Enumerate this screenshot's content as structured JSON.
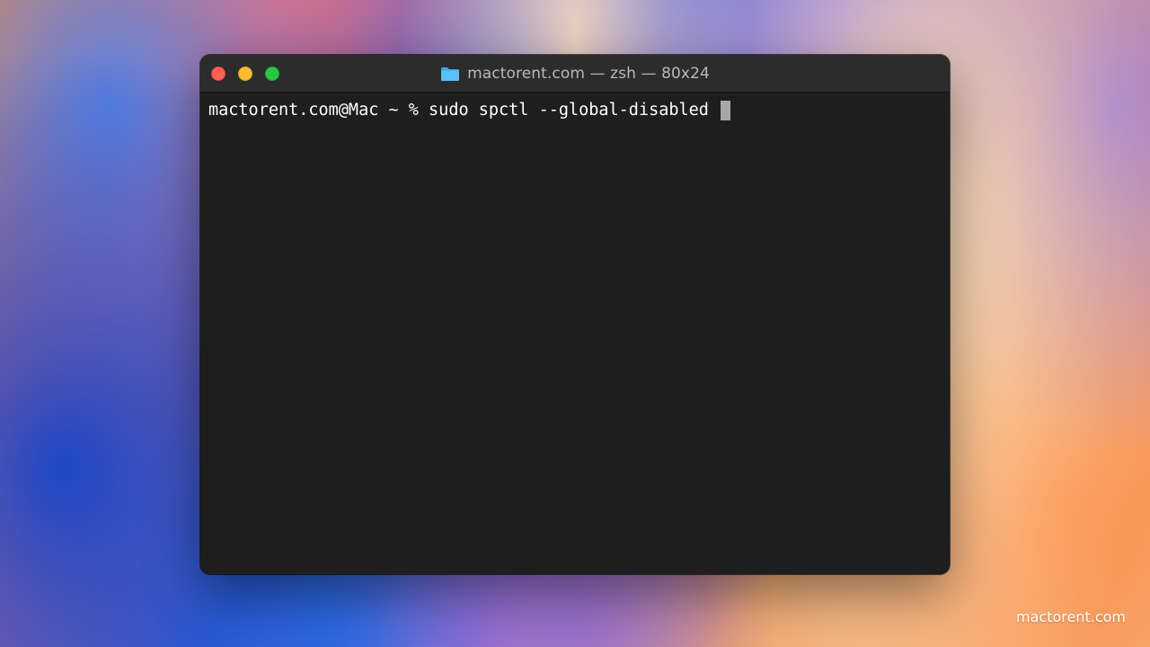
{
  "window": {
    "title": "mactorent.com — zsh — 80x24",
    "title_icon": "folder-icon",
    "traffic_lights": {
      "close_color": "#fe5f57",
      "minimize_color": "#febc2e",
      "maximize_color": "#28c840"
    }
  },
  "terminal": {
    "prompt": "mactorent.com@Mac ~ % ",
    "command": "sudo spctl --global-disabled ",
    "background": "#1e1e1e",
    "text_color": "#ffffff"
  },
  "watermark": "mactorent.com"
}
